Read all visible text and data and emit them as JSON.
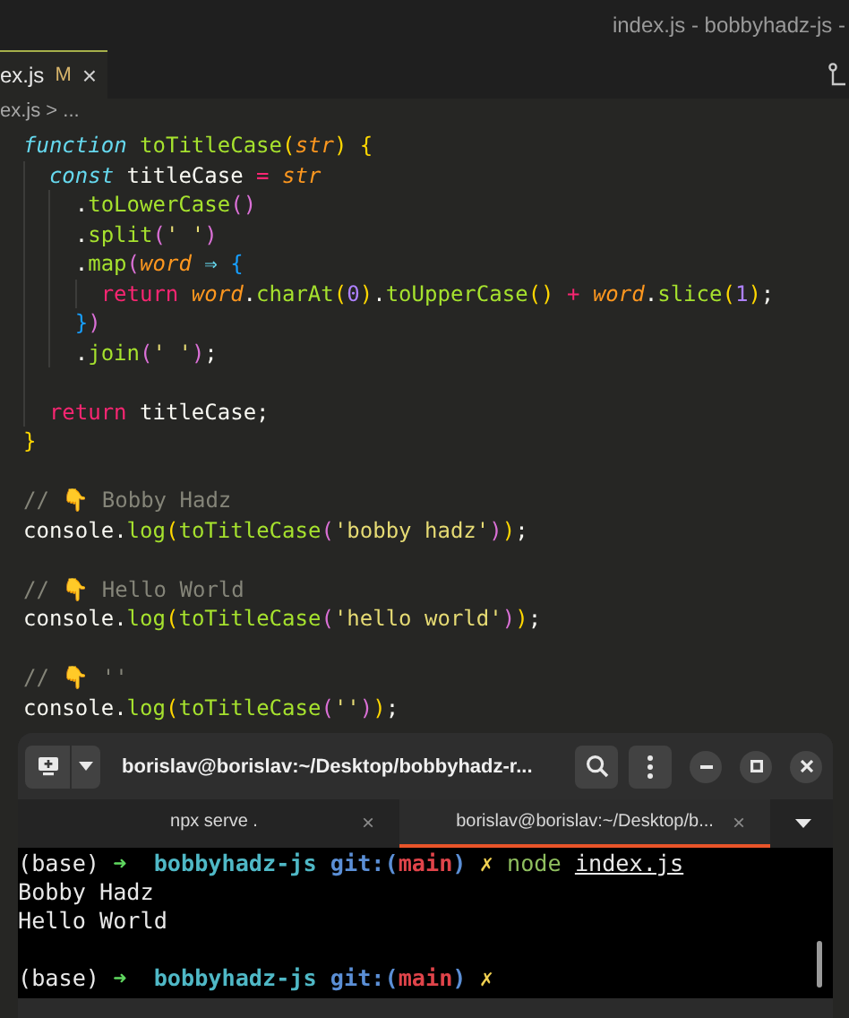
{
  "title_bar": {
    "title": "index.js - bobbyhadz-js -"
  },
  "editor_tabs": [
    {
      "label": "ex.js",
      "status": "M",
      "close": "×",
      "selected": true
    }
  ],
  "breadcrumb": "ex.js > ...",
  "code_lines": [
    {
      "kind": "code",
      "tokens": [
        {
          "t": "function ",
          "kind": "keyword"
        },
        {
          "t": "toTitleCase",
          "kind": "fn"
        },
        {
          "t": "(",
          "kind": "bracket1"
        },
        {
          "t": "str",
          "kind": "param"
        },
        {
          "t": ")",
          "kind": "bracket1"
        },
        {
          "t": " {",
          "kind": "bracket1"
        }
      ],
      "children": [
        {
          "kind": "code",
          "tokens": [
            {
              "t": "const ",
              "kind": "keyword"
            },
            {
              "t": "titleCase ",
              "kind": "plain"
            },
            {
              "t": "= ",
              "kind": "op"
            },
            {
              "t": "str",
              "kind": "param"
            }
          ],
          "children": [
            {
              "kind": "code",
              "tokens": [
                {
                  "t": ".",
                  "kind": "plain"
                },
                {
                  "t": "toLowerCase",
                  "kind": "fn"
                },
                {
                  "t": "()",
                  "kind": "bracket2"
                }
              ]
            },
            {
              "kind": "code",
              "tokens": [
                {
                  "t": ".",
                  "kind": "plain"
                },
                {
                  "t": "split",
                  "kind": "fn"
                },
                {
                  "t": "(",
                  "kind": "bracket2"
                },
                {
                  "t": "' '",
                  "kind": "string"
                },
                {
                  "t": ")",
                  "kind": "bracket2"
                }
              ]
            },
            {
              "kind": "code",
              "tokens": [
                {
                  "t": ".",
                  "kind": "plain"
                },
                {
                  "t": "map",
                  "kind": "fn"
                },
                {
                  "t": "(",
                  "kind": "bracket2"
                },
                {
                  "t": "word ",
                  "kind": "param"
                },
                {
                  "t": "⇒ ",
                  "kind": "keyword"
                },
                {
                  "t": "{",
                  "kind": "bracket3"
                }
              ],
              "children": [
                {
                  "kind": "code",
                  "tokens": [
                    {
                      "t": "return ",
                      "kind": "return"
                    },
                    {
                      "t": "word",
                      "kind": "param"
                    },
                    {
                      "t": ".",
                      "kind": "plain"
                    },
                    {
                      "t": "charAt",
                      "kind": "fn"
                    },
                    {
                      "t": "(",
                      "kind": "bracket1"
                    },
                    {
                      "t": "0",
                      "kind": "number"
                    },
                    {
                      "t": ")",
                      "kind": "bracket1"
                    },
                    {
                      "t": ".",
                      "kind": "plain"
                    },
                    {
                      "t": "toUpperCase",
                      "kind": "fn"
                    },
                    {
                      "t": "() ",
                      "kind": "bracket1"
                    },
                    {
                      "t": "+ ",
                      "kind": "op"
                    },
                    {
                      "t": "word",
                      "kind": "param"
                    },
                    {
                      "t": ".",
                      "kind": "plain"
                    },
                    {
                      "t": "slice",
                      "kind": "fn"
                    },
                    {
                      "t": "(",
                      "kind": "bracket1"
                    },
                    {
                      "t": "1",
                      "kind": "number"
                    },
                    {
                      "t": ")",
                      "kind": "bracket1"
                    },
                    {
                      "t": ";",
                      "kind": "plain"
                    }
                  ]
                }
              ]
            },
            {
              "kind": "code",
              "tokens": [
                {
                  "t": "}",
                  "kind": "bracket3"
                },
                {
                  "t": ")",
                  "kind": "bracket2"
                }
              ]
            },
            {
              "kind": "code",
              "tokens": [
                {
                  "t": ".",
                  "kind": "plain"
                },
                {
                  "t": "join",
                  "kind": "fn"
                },
                {
                  "t": "(",
                  "kind": "bracket2"
                },
                {
                  "t": "' '",
                  "kind": "string"
                },
                {
                  "t": ")",
                  "kind": "bracket2"
                },
                {
                  "t": ";",
                  "kind": "plain"
                }
              ]
            }
          ]
        },
        {
          "kind": "blank"
        },
        {
          "kind": "code",
          "tokens": [
            {
              "t": "return ",
              "kind": "return"
            },
            {
              "t": "titleCase;",
              "kind": "plain"
            }
          ]
        }
      ]
    },
    {
      "kind": "code",
      "tokens": [
        {
          "t": "}",
          "kind": "bracket1"
        }
      ]
    },
    {
      "kind": "blank"
    },
    {
      "kind": "code",
      "tokens": [
        {
          "t": "// 👇 Bobby Hadz",
          "kind": "comment"
        }
      ]
    },
    {
      "kind": "code",
      "tokens": [
        {
          "t": "console.",
          "kind": "plain"
        },
        {
          "t": "log",
          "kind": "fn"
        },
        {
          "t": "(",
          "kind": "bracket1"
        },
        {
          "t": "toTitleCase",
          "kind": "fn"
        },
        {
          "t": "(",
          "kind": "bracket2"
        },
        {
          "t": "'bobby hadz'",
          "kind": "string"
        },
        {
          "t": ")",
          "kind": "bracket2"
        },
        {
          "t": ")",
          "kind": "bracket1"
        },
        {
          "t": ";",
          "kind": "plain"
        }
      ]
    },
    {
      "kind": "blank"
    },
    {
      "kind": "code",
      "tokens": [
        {
          "t": "// 👇 Hello World",
          "kind": "comment"
        }
      ]
    },
    {
      "kind": "code",
      "tokens": [
        {
          "t": "console.",
          "kind": "plain"
        },
        {
          "t": "log",
          "kind": "fn"
        },
        {
          "t": "(",
          "kind": "bracket1"
        },
        {
          "t": "toTitleCase",
          "kind": "fn"
        },
        {
          "t": "(",
          "kind": "bracket2"
        },
        {
          "t": "'hello world'",
          "kind": "string"
        },
        {
          "t": ")",
          "kind": "bracket2"
        },
        {
          "t": ")",
          "kind": "bracket1"
        },
        {
          "t": ";",
          "kind": "plain"
        }
      ]
    },
    {
      "kind": "blank"
    },
    {
      "kind": "code",
      "tokens": [
        {
          "t": "// 👇 ''",
          "kind": "comment"
        }
      ]
    },
    {
      "kind": "code",
      "tokens": [
        {
          "t": "console.",
          "kind": "plain"
        },
        {
          "t": "log",
          "kind": "fn"
        },
        {
          "t": "(",
          "kind": "bracket1"
        },
        {
          "t": "toTitleCase",
          "kind": "fn"
        },
        {
          "t": "(",
          "kind": "bracket2"
        },
        {
          "t": "''",
          "kind": "string"
        },
        {
          "t": ")",
          "kind": "bracket2"
        },
        {
          "t": ")",
          "kind": "bracket1"
        },
        {
          "t": ";",
          "kind": "plain"
        }
      ]
    }
  ],
  "terminal": {
    "title": "borislav@borislav:~/Desktop/bobbyhadz-r...",
    "tabs": [
      {
        "label": "npx serve .",
        "close": "×",
        "selected": false
      },
      {
        "label": "borislav@borislav:~/Desktop/b...",
        "close": "×",
        "selected": true
      }
    ],
    "lines": [
      {
        "kind": "text",
        "tokens": [
          {
            "t": "(base) ",
            "kind": "plain"
          },
          {
            "t": "➜  ",
            "kind": "arrow"
          },
          {
            "t": "bobbyhadz-js",
            "kind": "dir"
          },
          {
            "t": " git:(",
            "kind": "git"
          },
          {
            "t": "main",
            "kind": "branch"
          },
          {
            "t": ")",
            "kind": "git"
          },
          {
            "t": " ✗ ",
            "kind": "dirty"
          },
          {
            "t": "node ",
            "kind": "cmd"
          },
          {
            "t": "index.js",
            "kind": "path"
          }
        ]
      },
      {
        "kind": "text",
        "tokens": [
          {
            "t": "Bobby Hadz",
            "kind": "plain"
          }
        ]
      },
      {
        "kind": "text",
        "tokens": [
          {
            "t": "Hello World",
            "kind": "plain"
          }
        ]
      },
      {
        "kind": "blank"
      },
      {
        "kind": "text",
        "tokens": [
          {
            "t": "(base) ",
            "kind": "plain"
          },
          {
            "t": "➜  ",
            "kind": "arrow"
          },
          {
            "t": "bobbyhadz-js",
            "kind": "dir"
          },
          {
            "t": " git:(",
            "kind": "git"
          },
          {
            "t": "main",
            "kind": "branch"
          },
          {
            "t": ")",
            "kind": "git"
          },
          {
            "t": " ✗",
            "kind": "dirty"
          }
        ]
      }
    ]
  }
}
